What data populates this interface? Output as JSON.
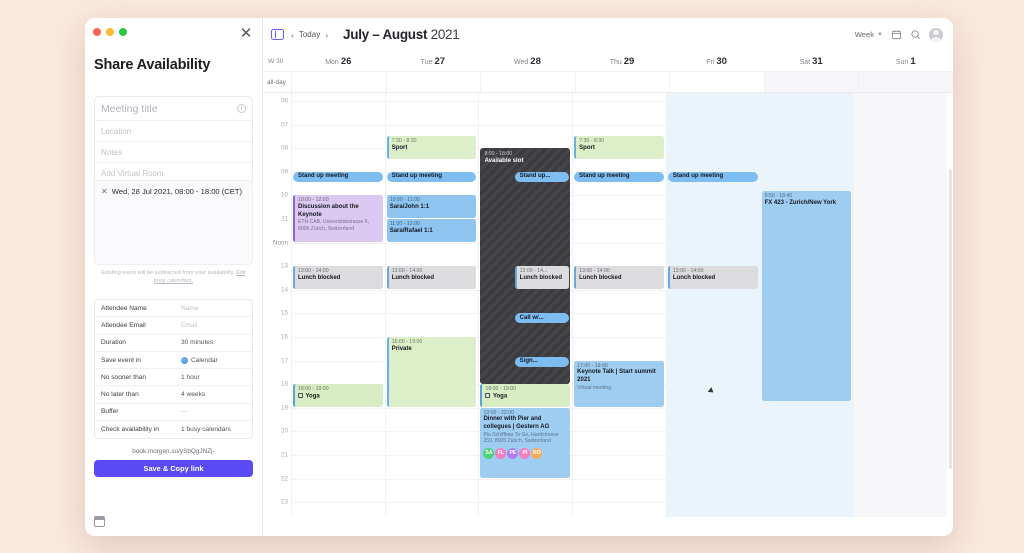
{
  "share_panel": {
    "title": "Share Availability",
    "close_icon": "close-icon",
    "info_icon": "info-icon",
    "fields": [
      {
        "name": "meeting-title",
        "placeholder": "Meeting title"
      },
      {
        "name": "location",
        "placeholder": "Location"
      },
      {
        "name": "notes",
        "placeholder": "Notes"
      },
      {
        "name": "virtual-room",
        "placeholder": "Add Virtual Room"
      }
    ],
    "busy_chip": "Wed, 28 Jul 2021, 08:00 - 18:00 (CET)",
    "busy_note": "Existing event will be subtracted from your availability.",
    "busy_note_link": "Edit busy calendars.",
    "settings": [
      {
        "key": "Attendee Name",
        "value": "Name",
        "placeholder": true
      },
      {
        "key": "Attendee Email",
        "value": "Email",
        "placeholder": true
      },
      {
        "key": "Duration",
        "value": "30 minutes",
        "placeholder": false
      },
      {
        "key": "Save event in",
        "value": "Calendar",
        "placeholder": false,
        "dot": true
      },
      {
        "key": "No sooner than",
        "value": "1 hour",
        "placeholder": false
      },
      {
        "key": "No later than",
        "value": "4 weeks",
        "placeholder": false
      },
      {
        "key": "Buffer",
        "value": "—",
        "placeholder": false
      },
      {
        "key": "Check availability in",
        "value": "1 busy calendars",
        "placeholder": false
      }
    ],
    "share_link": "book.morgen.so/ySbQgJNZj-",
    "save_button": "Save & Copy link",
    "footer_icon": "calendar-icon"
  },
  "calendar": {
    "today_label": "Today",
    "prev_icon": "chevron-left-icon",
    "next_icon": "chevron-right-icon",
    "sidebar_toggle_icon": "sidebar-toggle-icon",
    "range_month": "July – August",
    "range_year": "2021",
    "view": "Week",
    "view_chevron": "chevron-down-icon",
    "date_picker_icon": "calendar-icon",
    "search_icon": "search-icon",
    "avatar_icon": "avatar-icon",
    "week_number": "W 30",
    "allday_label": "all-day",
    "days": [
      {
        "dow": "Mon",
        "num": "26"
      },
      {
        "dow": "Tue",
        "num": "27"
      },
      {
        "dow": "Wed",
        "num": "28"
      },
      {
        "dow": "Thu",
        "num": "29"
      },
      {
        "dow": "Fri",
        "num": "30"
      },
      {
        "dow": "Sat",
        "num": "31"
      },
      {
        "dow": "Sun",
        "num": "1"
      }
    ],
    "time_labels": [
      "06",
      "07",
      "08",
      "09",
      "10",
      "11",
      "Noon",
      "13",
      "14",
      "15",
      "16",
      "17",
      "18",
      "19",
      "20",
      "21",
      "22",
      "23"
    ],
    "available_slot": {
      "time": "8:00 - 18:00",
      "name": "Available slot",
      "day": "Wed 28"
    },
    "events": [
      {
        "day": 0,
        "time": "",
        "name": "Stand up meeting",
        "style": "blue-pill",
        "start": "09:00",
        "end": "09:20"
      },
      {
        "day": 0,
        "time": "10:00 - 12:00",
        "name": "Discussion about the Keynote",
        "sub": "ETH CAB, Universitätstrasse 6, 8006 Zürich, Switzerland",
        "style": "purple",
        "start": "10:00",
        "end": "12:00"
      },
      {
        "day": 0,
        "time": "13:00 - 14:00",
        "name": "Lunch blocked",
        "style": "gray",
        "start": "13:00",
        "end": "14:00"
      },
      {
        "day": 0,
        "time": "18:00 - 19:00",
        "name": "Yoga",
        "style": "green",
        "checkbox": true,
        "start": "18:00",
        "end": "19:00"
      },
      {
        "day": 1,
        "time": "7:30 - 8:30",
        "name": "Sport",
        "style": "green2",
        "start": "07:30",
        "end": "08:30"
      },
      {
        "day": 1,
        "time": "",
        "name": "Stand up meeting",
        "style": "blue-pill",
        "start": "09:00",
        "end": "09:20"
      },
      {
        "day": 1,
        "time": "10:00 - 11:00",
        "name": "Sara/John 1:1",
        "style": "blue",
        "start": "10:00",
        "end": "11:00"
      },
      {
        "day": 1,
        "time": "11:00 - 12:00",
        "name": "Sara/Rafael 1:1",
        "style": "blue",
        "start": "11:00",
        "end": "12:00"
      },
      {
        "day": 1,
        "time": "13:00 - 14:00",
        "name": "Lunch blocked",
        "style": "gray",
        "start": "13:00",
        "end": "14:00"
      },
      {
        "day": 1,
        "time": "16:00 - 19:00",
        "name": "Private",
        "style": "green2",
        "start": "16:00",
        "end": "19:00"
      },
      {
        "day": 2,
        "time": "",
        "name": "Stand up...",
        "style": "blue-pill",
        "in_slot": true,
        "start": "09:00",
        "end": "09:20"
      },
      {
        "day": 2,
        "time": "13:00 - 14...",
        "name": "Lunch blocked",
        "style": "gray",
        "in_slot": true,
        "start": "13:00",
        "end": "14:00"
      },
      {
        "day": 2,
        "time": "",
        "name": "Call w/...",
        "style": "blue-pill",
        "in_slot": true,
        "start": "15:00",
        "end": "15:20"
      },
      {
        "day": 2,
        "time": "",
        "name": "Sign...",
        "style": "blue-pill",
        "in_slot": true,
        "start": "16:50",
        "end": "17:10"
      },
      {
        "day": 2,
        "time": "18:00 - 19:00",
        "name": "Yoga",
        "style": "green",
        "checkbox": true,
        "start": "18:00",
        "end": "19:00"
      },
      {
        "day": 2,
        "time": "19:00 - 22:00",
        "name": "Dinner with Pier and collegues | Gestern AG",
        "sub": "Piu Schiffbau To Go, Hardstrasse 259, 8005 Zürich, Switzerland",
        "style": "lightblue",
        "start": "19:00",
        "end": "22:00",
        "attendees": [
          {
            "initials": "SA",
            "color": "#4fd07a"
          },
          {
            "initials": "FL",
            "color": "#f07fc0"
          },
          {
            "initials": "PE",
            "color": "#b07ef0"
          },
          {
            "initials": "PI",
            "color": "#f07fbf"
          },
          {
            "initials": "RO",
            "color": "#f3ab5c"
          }
        ]
      },
      {
        "day": 3,
        "time": "7:30 - 8:30",
        "name": "Sport",
        "style": "green2",
        "start": "07:30",
        "end": "08:30"
      },
      {
        "day": 3,
        "time": "",
        "name": "Stand up meeting",
        "style": "blue-pill",
        "start": "09:00",
        "end": "09:20"
      },
      {
        "day": 3,
        "time": "13:00 - 14:00",
        "name": "Lunch blocked",
        "style": "gray",
        "start": "13:00",
        "end": "14:00"
      },
      {
        "day": 3,
        "time": "17:00 - 19:00",
        "name": "Keynote Talk | Start summit 2021",
        "sub": "Virtual meeting",
        "style": "lightblue",
        "start": "17:00",
        "end": "19:00"
      },
      {
        "day": 4,
        "time": "",
        "name": "Stand up meeting",
        "style": "blue-pill",
        "start": "09:00",
        "end": "09:20"
      },
      {
        "day": 4,
        "time": "13:00 - 14:00",
        "name": "Lunch blocked",
        "style": "gray",
        "start": "13:00",
        "end": "14:00"
      },
      {
        "day": 5,
        "time": "9:50 - 18:45",
        "name": "FX 423 - Zurich/New York",
        "style": "lightblue",
        "start": "09:50",
        "end": "18:45"
      }
    ]
  },
  "colors": {
    "accent": "#5a4af4",
    "window_bg": "#ffffff",
    "desktop_bg": "#fbe9dd",
    "slot_overlay": "#3b3b40"
  }
}
